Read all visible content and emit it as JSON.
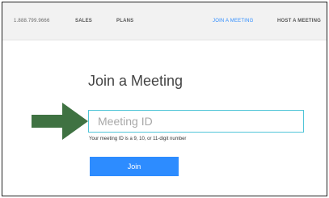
{
  "nav": {
    "phone": "1.888.799.9666",
    "sales": "SALES",
    "plans": "PLANS",
    "join": "JOIN A MEETING",
    "host": "HOST A MEETING"
  },
  "main": {
    "title": "Join a Meeting",
    "meeting_id_placeholder": "Meeting ID",
    "meeting_id_value": "",
    "helper": "Your meeting ID is a 9, 10, or 11-digit number",
    "join_label": "Join"
  },
  "annotation": {
    "icon": "arrow-right-icon"
  },
  "colors": {
    "accent": "#2d8cff",
    "input_border": "#51c5d8",
    "arrow": "#3f7242",
    "nav_bg": "#f2f2f2"
  }
}
